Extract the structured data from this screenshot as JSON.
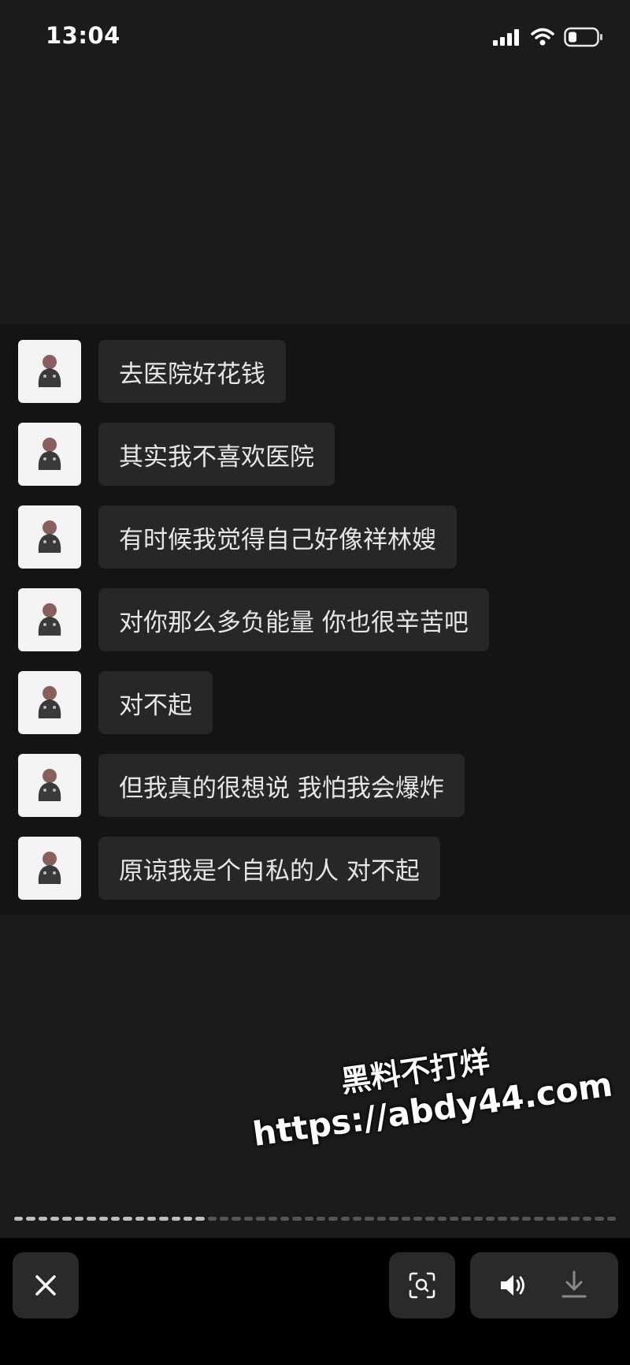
{
  "status_bar": {
    "time": "13:04"
  },
  "messages": [
    {
      "text": "去医院好花钱"
    },
    {
      "text": "其实我不喜欢医院"
    },
    {
      "text": "有时候我觉得自己好像祥林嫂"
    },
    {
      "text": "对你那么多负能量 你也很辛苦吧"
    },
    {
      "text": "对不起"
    },
    {
      "text": "但我真的很想说 我怕我会爆炸"
    },
    {
      "text": "原谅我是个自私的人 对不起"
    }
  ],
  "watermark": {
    "line1": "黑料不打烊",
    "line2": "https://abdy44.com"
  },
  "progress": {
    "total_segments": 50,
    "completed_segments": 16
  },
  "bottom_bar": {
    "close_icon": "close-icon",
    "lens_icon": "visual-search-icon",
    "volume_icon": "speaker-icon",
    "download_icon": "download-icon"
  }
}
